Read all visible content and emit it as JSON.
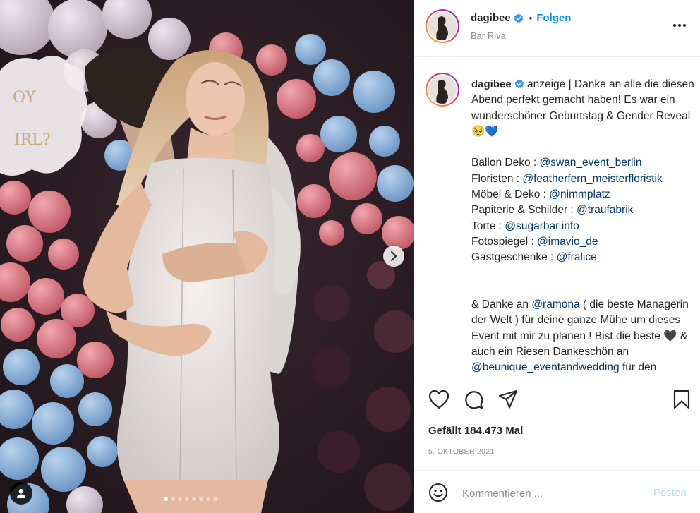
{
  "post": {
    "username": "dagibee",
    "follow_label": "Folgen",
    "separator": "•",
    "location": "Bar Riva"
  },
  "caption": {
    "username": "dagibee",
    "intro": " anzeige | Danke an alle die diesen Abend perfekt gemacht haben! Es war ein wunderschöner Geburtstag & Gender Reveal 🥺💙",
    "credits": [
      {
        "label": "Ballon Deko : ",
        "mention": "@swan_event_berlin"
      },
      {
        "label": "Floristen : ",
        "mention": "@featherfern_meisterfloristik"
      },
      {
        "label": "Möbel & Deko : ",
        "mention": "@nimmplatz"
      },
      {
        "label": "Papiterie & Schilder : ",
        "mention": "@traufabrik"
      },
      {
        "label": "Torte : ",
        "mention": "@sugarbar.info"
      },
      {
        "label": "Fotospiegel : ",
        "mention": "@imavio_de"
      },
      {
        "label": "Gastgeschenke : ",
        "mention": "@fralice_"
      }
    ],
    "outro_prefix": "& Danke an ",
    "outro_mention": "@ramona",
    "outro_text": " ( die beste Managerin der Welt ) für deine ganze Mühe um dieses Event mit mir zu planen ! Bist die beste 🖤 & auch ein Riesen Dankeschön an ",
    "outro_mention2": "@beunique_eventandwedding",
    "outro_tail": " für den"
  },
  "stats": {
    "likes": "Gefällt 184.473 Mal",
    "date": "5. OKTOBER 2021"
  },
  "comment": {
    "placeholder": "Kommentieren ...",
    "post_label": "Posten"
  },
  "carousel": {
    "slide_count": 8,
    "active_index": 0
  },
  "icons": {
    "verified": "verified-badge-icon",
    "more": "more-options-icon",
    "like": "heart-icon",
    "comment": "comment-icon",
    "share": "share-icon",
    "save": "bookmark-icon",
    "emoji": "emoji-icon",
    "next": "chevron-right-icon",
    "tags": "user-tag-icon"
  },
  "colors": {
    "accent": "#0095f6",
    "mention": "#00376b",
    "muted": "#8e8e8e",
    "post_disabled": "#b2dffc"
  }
}
